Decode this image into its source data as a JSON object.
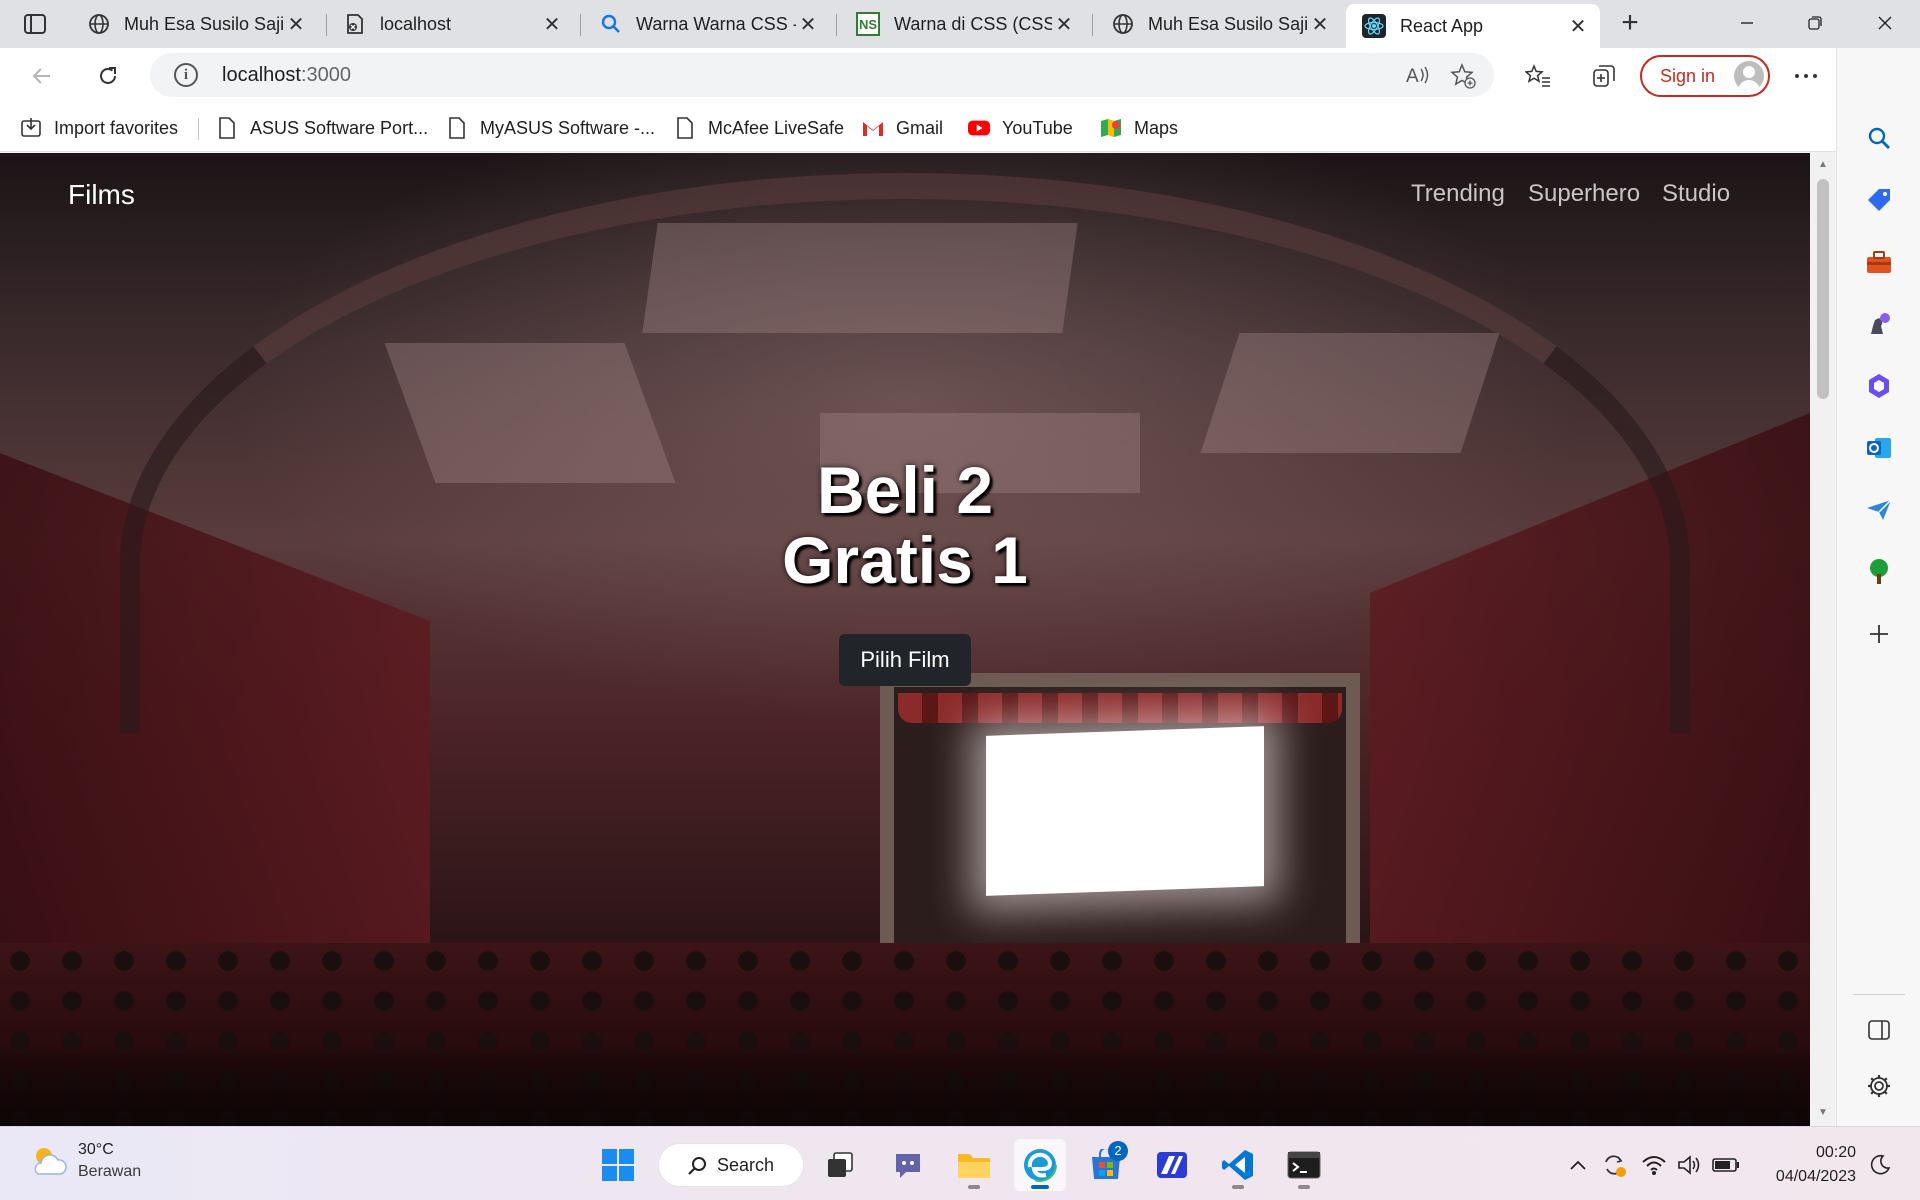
{
  "browser": {
    "tabs": [
      {
        "title": "Muh Esa Susilo Sajid",
        "icon": "globe-icon"
      },
      {
        "title": "localhost",
        "icon": "broken-page-icon"
      },
      {
        "title": "Warna Warna CSS - ",
        "icon": "search-icon"
      },
      {
        "title": "Warna di CSS (CSS C",
        "icon": "ns-site-icon"
      },
      {
        "title": "Muh Esa Susilo Sajid",
        "icon": "globe-icon"
      },
      {
        "title": "React App",
        "icon": "react-icon"
      }
    ],
    "url_host": "localhost",
    "url_port": ":3000",
    "signin_label": "Sign in",
    "favorites": [
      {
        "label": "Import favorites",
        "icon": "import-icon"
      },
      {
        "label": "ASUS Software Port...",
        "icon": "page-icon"
      },
      {
        "label": "MyASUS Software -...",
        "icon": "page-icon"
      },
      {
        "label": "McAfee LiveSafe",
        "icon": "page-icon"
      },
      {
        "label": "Gmail",
        "icon": "gmail-icon"
      },
      {
        "label": "YouTube",
        "icon": "youtube-icon"
      },
      {
        "label": "Maps",
        "icon": "maps-icon"
      }
    ]
  },
  "page": {
    "brand": "Films",
    "nav": [
      "Trending",
      "Superhero",
      "Studio"
    ],
    "headline_line1": "Beli 2",
    "headline_line2": "Gratis 1",
    "cta_label": "Pilih Film"
  },
  "taskbar": {
    "weather_temp": "30°C",
    "weather_cond": "Berawan",
    "search_label": "Search",
    "store_badge": "2",
    "time": "00:20",
    "date": "04/04/2023"
  },
  "colors": {
    "accent_red": "#c42b1c",
    "cta_bg": "#212529",
    "edge_blue": "#0067c0"
  }
}
